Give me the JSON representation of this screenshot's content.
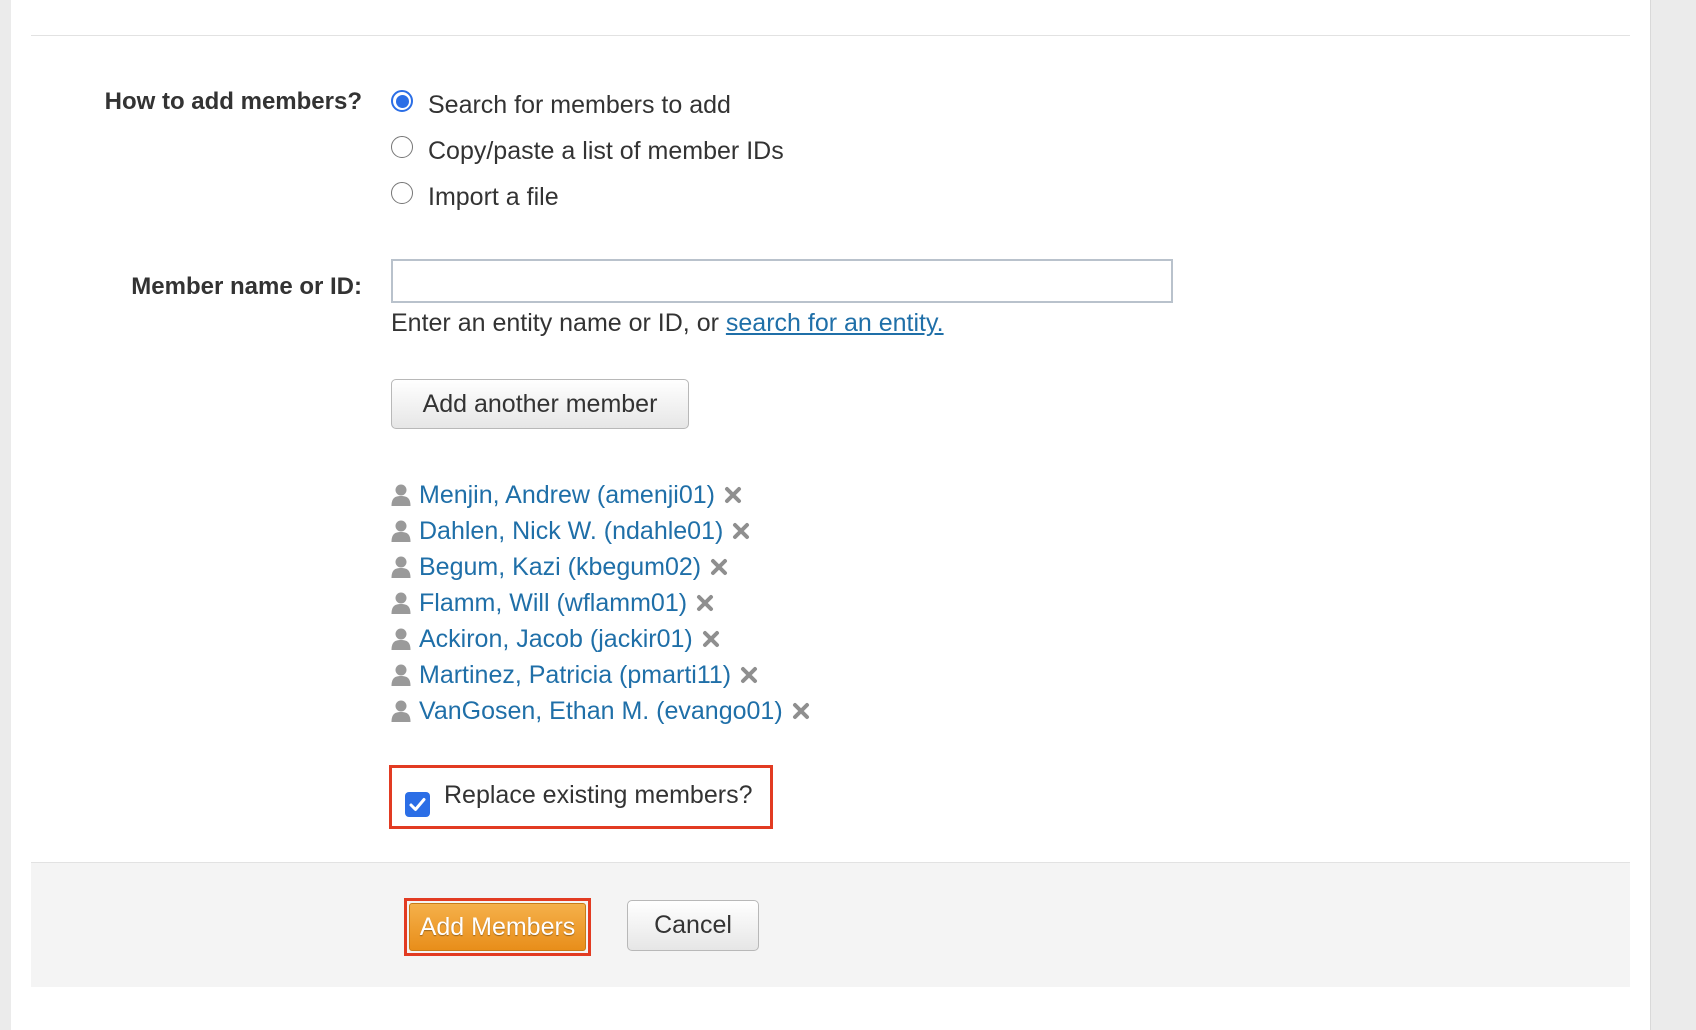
{
  "how_to_add": {
    "label": "How to add members?",
    "options": [
      {
        "label": "Search for members to add",
        "selected": true
      },
      {
        "label": "Copy/paste a list of member IDs",
        "selected": false
      },
      {
        "label": "Import a file",
        "selected": false
      }
    ]
  },
  "member_field": {
    "label": "Member name or ID:",
    "value": "",
    "help_prefix": "Enter an entity name or ID, or ",
    "help_link": "search for an entity."
  },
  "add_another_label": "Add another member",
  "members": [
    "Menjin, Andrew (amenji01)",
    "Dahlen, Nick W. (ndahle01)",
    "Begum, Kazi (kbegum02)",
    "Flamm, Will (wflamm01)",
    "Ackiron, Jacob (jackir01)",
    "Martinez, Patricia (pmarti11)",
    "VanGosen, Ethan M. (evango01)"
  ],
  "replace_existing": {
    "label": "Replace existing members?",
    "checked": true
  },
  "footer": {
    "primary_label": "Add Members",
    "cancel_label": "Cancel"
  },
  "colors": {
    "accent_blue": "#2b6ee6",
    "link": "#1f6fa8",
    "highlight_border": "#e23b22",
    "primary_button": "#f0a236"
  }
}
